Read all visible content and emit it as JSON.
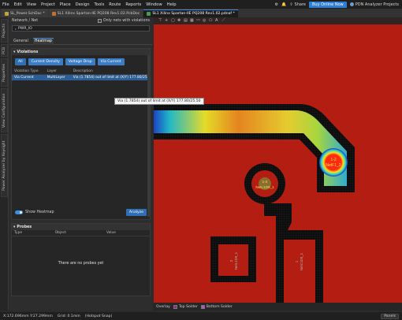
{
  "menubar": {
    "items": [
      "File",
      "Edit",
      "View",
      "Project",
      "Place",
      "Design",
      "Tools",
      "Route",
      "Reports",
      "Window",
      "Help"
    ],
    "share": "Share",
    "buy": "Buy Online Now",
    "project": "PDN Analyzer Projects"
  },
  "tabs": [
    {
      "label": "SL_Power.SchDoc *",
      "color": "#c0a33a"
    },
    {
      "label": "SL1 Xilinx Spartan-IIE PQ208 Rev1.02.PcbDoc",
      "color": "#c96f2a"
    },
    {
      "label": "SL1 Xilinx Spartan-IIE PQ208 Rev1.02.pdnaf *",
      "color": "#4f9a4a"
    }
  ],
  "vstrip": [
    "Projects",
    "PCB",
    "Properties",
    "View Configuration",
    "Power Analyzer by Keysight"
  ],
  "panel": {
    "network_label": "Network / Net",
    "only_nets_label": "Only nets with violations",
    "net_value": "PWR_IO",
    "subtabs": [
      "General",
      "Heatmap"
    ],
    "violations": {
      "title": "Violations",
      "buttons": [
        "All",
        "Current Density",
        "Voltage Drop",
        "Via Current"
      ],
      "headers": [
        "Violation Type",
        "Layer",
        "Description"
      ],
      "row": [
        "Via Current",
        "MultiLayer",
        "Via (1.7854) out of limit at (X/Y) 177.80/25.50"
      ]
    },
    "show_heatmap": "Show Heatmap",
    "analyze": "Analyze",
    "probes": {
      "title": "Probes",
      "headers": [
        "Type",
        "Object",
        "Value"
      ],
      "empty": "There are no probes yet"
    }
  },
  "tooltip": "Via (1.7854) out of limit at (X/Y) 177.80/25.50",
  "canvas": {
    "labels": [
      {
        "line1": "1-2",
        "line2": "NetF1_2"
      },
      {
        "line1": "1-2",
        "line2": "NetL1D9_1"
      },
      {
        "line1": "2",
        "line2": "NetL1D9_1"
      },
      {
        "line1": "1",
        "line2": "NetC109_1"
      }
    ]
  },
  "layerbar": {
    "items": [
      "Overlay",
      "Top Solder",
      "Bottom Solder"
    ],
    "colors": [
      "#d8d12a",
      "#8a2f8a",
      "#c24fc9"
    ]
  },
  "status": {
    "coords": "X:172.696mm Y:27.299mm",
    "grid": "Grid: 0.1mm",
    "snap": "(Hotspot Snap)",
    "panels": "Panels"
  }
}
